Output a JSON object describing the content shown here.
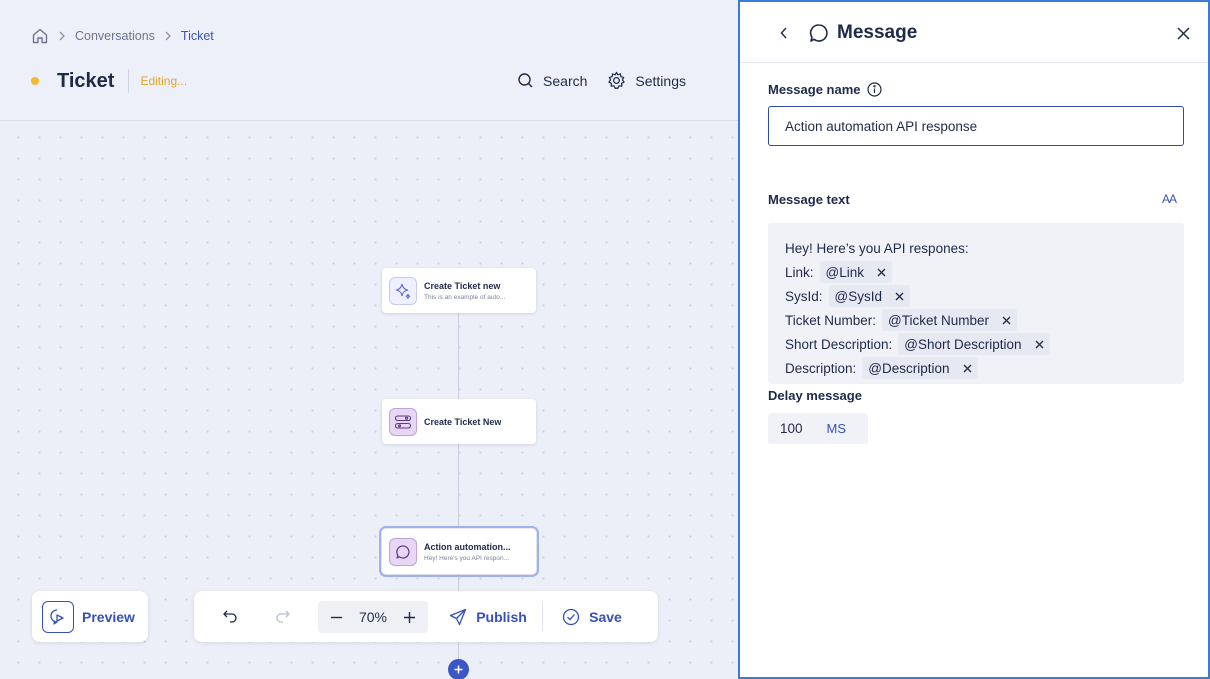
{
  "breadcrumb": {
    "home": "home",
    "items": [
      "Conversations",
      "Ticket"
    ]
  },
  "page": {
    "title": "Ticket",
    "status": "Editing..."
  },
  "header_actions": {
    "search": "Search",
    "settings": "Settings"
  },
  "nodes": [
    {
      "title": "Create Ticket new",
      "subtitle": "This is an example of auto..."
    },
    {
      "title": "Create Ticket New",
      "subtitle": ""
    },
    {
      "title": "Action automation...",
      "subtitle": "Hey! Here's you API respon..."
    }
  ],
  "preview": {
    "label": "Preview"
  },
  "toolbar": {
    "zoom": "70%",
    "publish": "Publish",
    "save": "Save"
  },
  "panel": {
    "title": "Message",
    "message_name_label": "Message name",
    "message_name_value": "Action automation API response",
    "message_text_label": "Message text",
    "text_format": "AA",
    "message_intro": "Hey! Here’s you API respones:",
    "message_lines": [
      {
        "label": "Link:",
        "tag": "@Link"
      },
      {
        "label": "SysId:",
        "tag": "@SysId"
      },
      {
        "label": "Ticket Number:",
        "tag": "@Ticket Number"
      },
      {
        "label": "Short Description:",
        "tag": "@Short Description"
      },
      {
        "label": "Description:",
        "tag": "@Description"
      }
    ],
    "delay_label": "Delay message",
    "delay_value": "100",
    "delay_unit": "MS"
  },
  "colors": {
    "accent": "#3650b8",
    "editing": "#e0a52a",
    "panel_border": "#3a7ad8"
  }
}
